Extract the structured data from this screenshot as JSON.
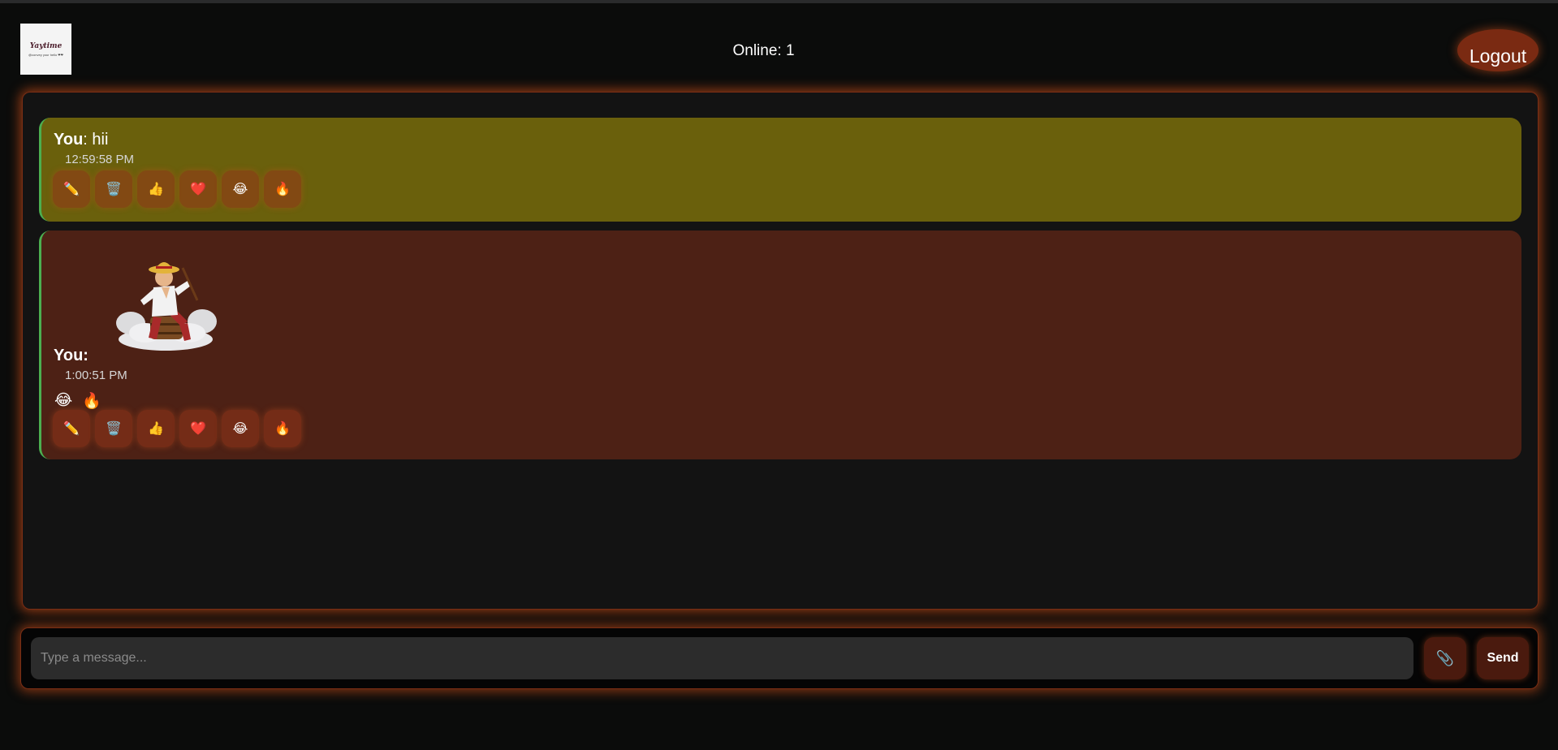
{
  "header": {
    "logo_text": "Yaytime",
    "logo_subtext": "@convey your hello ❤❤",
    "online_label": "Online: 1",
    "logout_label": "Logout"
  },
  "messages": [
    {
      "sender": "You",
      "separator": ":",
      "text": " hii",
      "time": "12:59:58 PM",
      "reactions": [],
      "has_image": false
    },
    {
      "sender": "You",
      "separator": ":",
      "text": "",
      "time": "1:00:51 PM",
      "reactions": [
        "😂",
        "🔥"
      ],
      "has_image": true,
      "image_alt": "straw hat pirate sticker"
    }
  ],
  "action_icons": [
    "✏️",
    "🗑️",
    "👍",
    "❤️",
    "😂",
    "🔥"
  ],
  "action_icon_names": [
    "pencil-icon",
    "trash-icon",
    "thumbs-up-icon",
    "heart-icon",
    "laugh-icon",
    "fire-icon"
  ],
  "composer": {
    "placeholder": "Type a message...",
    "attach_icon": "📎",
    "send_label": "Send"
  },
  "colors": {
    "accent_glow": "#d2501a",
    "own_message_bg": "#6a600c",
    "image_message_bg": "#4d2115",
    "message_border": "#4caf50"
  }
}
